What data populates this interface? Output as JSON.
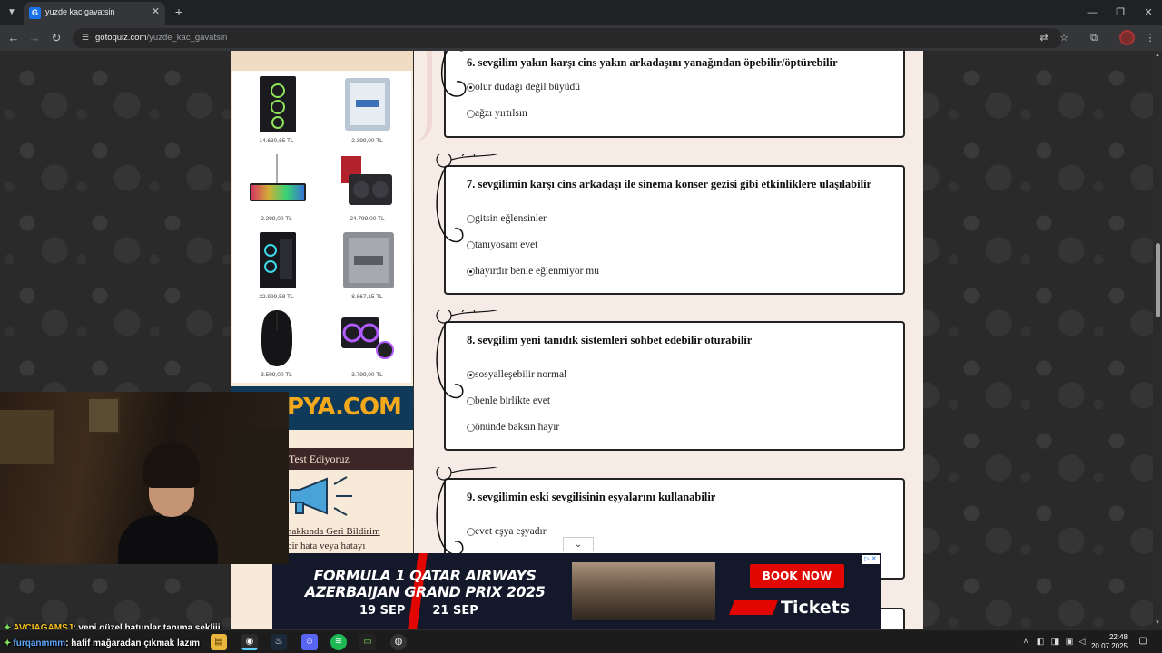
{
  "browser": {
    "tab_title": "yuzde kac gavatsin",
    "url_host": "gotoquiz.com",
    "url_path": "/yuzde_kac_gavatsin"
  },
  "sidebar": {
    "products": [
      {
        "price": "14.630,65 TL",
        "icon": "pc-case-icon"
      },
      {
        "price": "2.399,00 TL",
        "icon": "intel-cpu-icon"
      },
      {
        "price": "2.299,00 TL",
        "icon": "keyboard-icon"
      },
      {
        "price": "24.799,00 TL",
        "icon": "graphics-card-icon"
      },
      {
        "price": "22.999,58 TL",
        "icon": "pc-case-icon"
      },
      {
        "price": "8.867,15 TL",
        "icon": "amd-cpu-icon"
      },
      {
        "price": "3.599,00 TL",
        "icon": "mouse-icon"
      },
      {
        "price": "3.799,00 TL",
        "icon": "liquid-cooler-icon"
      }
    ],
    "ad_text": "PYA.COM",
    "section_title": "Test Ediyoruz",
    "feedback_link": "hakkında Geri Bildirim",
    "feedback_text": "bir hata veya hatayı"
  },
  "quiz": {
    "questions": [
      {
        "title": "6. sevgilim yakın karşı cins yakın arkadaşını yanağından öpebilir/öptürebilir",
        "options": [
          {
            "label": "olur dudağı değil büyüdü",
            "checked": true
          },
          {
            "label": "ağzı yırtılsın",
            "checked": false
          }
        ]
      },
      {
        "title": "7. sevgilimin karşı cins arkadaşı ile sinema konser gezisi gibi etkinliklere ulaşılabilir",
        "options": [
          {
            "label": "gitsin eğlensinler",
            "checked": false
          },
          {
            "label": "tanıyosam evet",
            "checked": false
          },
          {
            "label": "hayırdır benle eğlenmiyor mu",
            "checked": true
          }
        ]
      },
      {
        "title": "8. sevgilim yeni tanıdık sistemleri sohbet edebilir oturabilir",
        "options": [
          {
            "label": "sosyalleşebilir normal",
            "checked": true
          },
          {
            "label": "benle birlikte evet",
            "checked": false
          },
          {
            "label": "önünde baksın hayır",
            "checked": false
          }
        ]
      },
      {
        "title": "9. sevgilimin eski sevgilisinin eşyalarını kullanabilir",
        "options": [
          {
            "label": "evet eşya eşyadır",
            "checked": false
          }
        ]
      }
    ]
  },
  "f1_ad": {
    "headline": "FORMULA 1 QATAR AIRWAYS AZERBAIJAN GRAND PRIX 2025",
    "date_start": "19 SEP",
    "date_end": "21 SEP",
    "cta": "BOOK NOW",
    "brand": "Tickets"
  },
  "chat": [
    {
      "user": "AVCIAGAMSJ",
      "message": ": yeni güzel hatunlar tanıma şekliii"
    },
    {
      "user": "furqanmmm",
      "message": ": hafif mağaradan çıkmak lazım"
    }
  ],
  "taskbar": {
    "time": "22:48",
    "date": "20.07.2025"
  },
  "colors": {
    "card_border": "#222222",
    "page_bg": "#f7ebe6",
    "sidebar_bg": "#f8ead8",
    "f1_red": "#e10600"
  }
}
